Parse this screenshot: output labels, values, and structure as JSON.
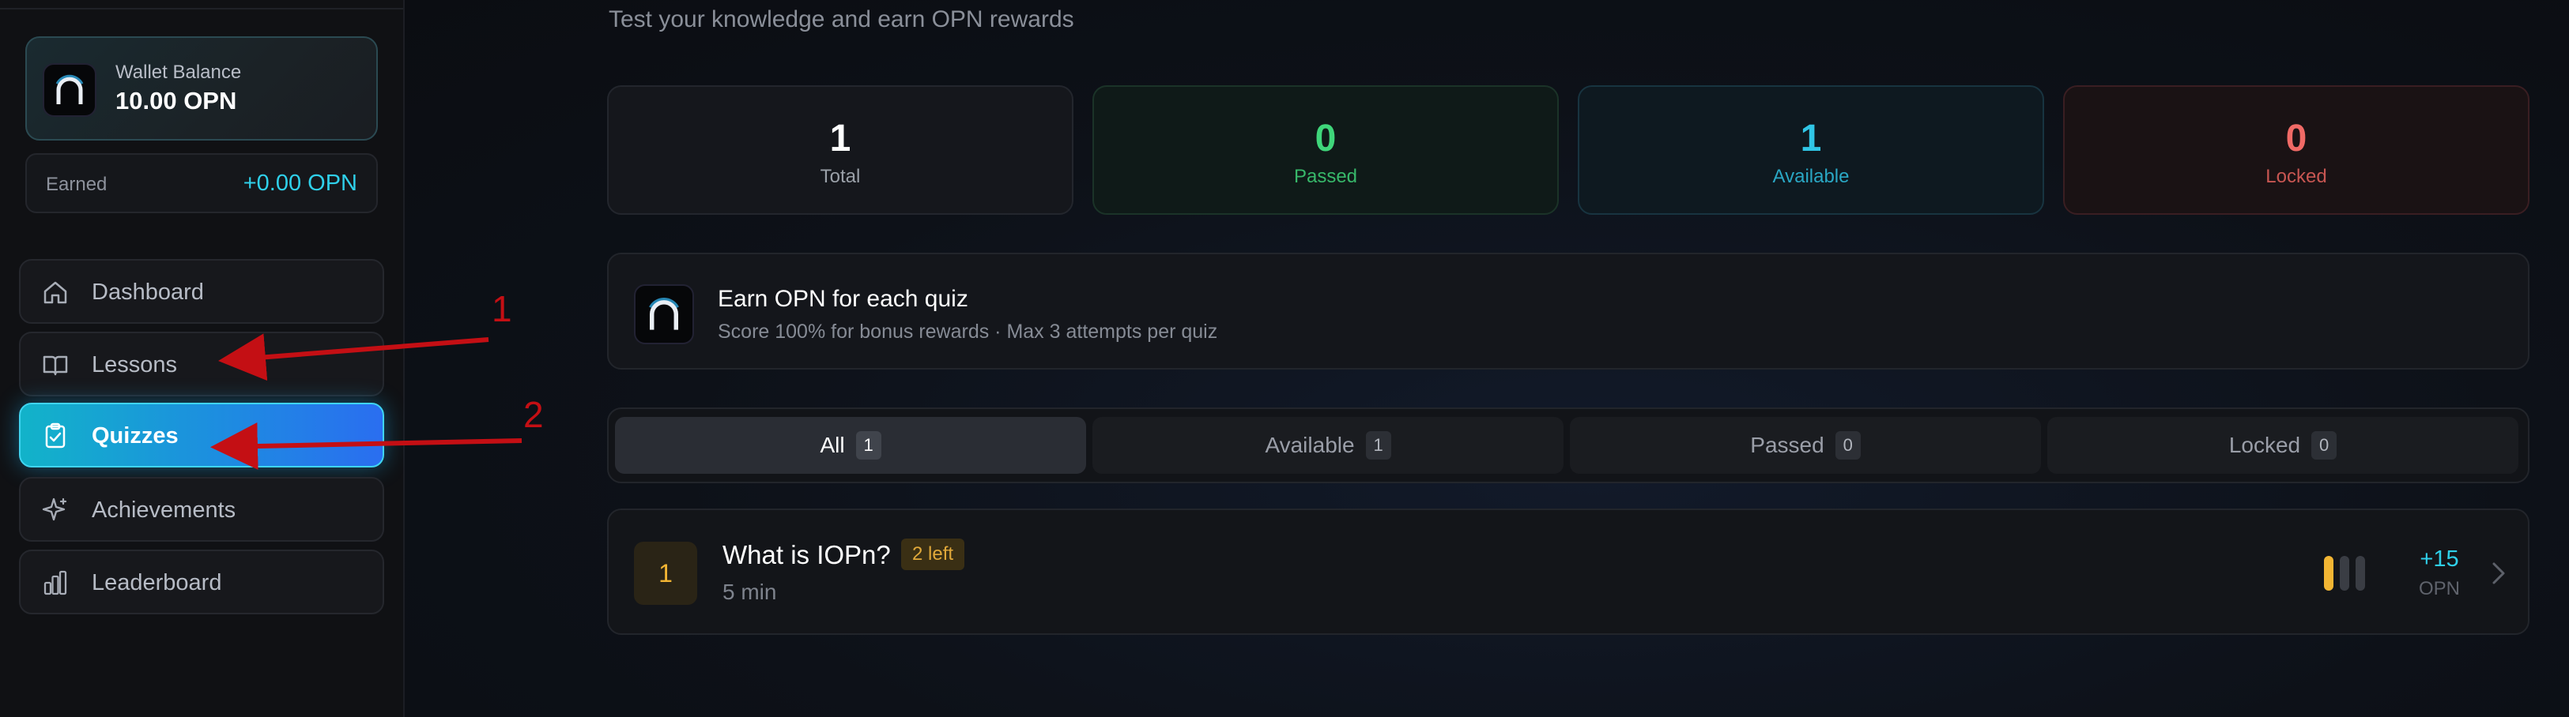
{
  "sidebar": {
    "wallet": {
      "label": "Wallet Balance",
      "value": "10.00 OPN"
    },
    "earned": {
      "label": "Earned",
      "value": "+0.00 OPN"
    },
    "nav": [
      {
        "label": "Dashboard",
        "icon": "home-icon"
      },
      {
        "label": "Lessons",
        "icon": "book-icon"
      },
      {
        "label": "Quizzes",
        "icon": "clipboard-check-icon"
      },
      {
        "label": "Achievements",
        "icon": "sparkle-icon"
      },
      {
        "label": "Leaderboard",
        "icon": "bar-chart-icon"
      }
    ],
    "active_item": "Quizzes"
  },
  "main": {
    "subtitle": "Test your knowledge and earn OPN rewards",
    "stats": [
      {
        "value": "1",
        "label": "Total",
        "color": "#ffffff",
        "label_color": "#9aa0a8"
      },
      {
        "value": "0",
        "label": "Passed",
        "color": "#3fd67a",
        "label_color": "#37b86a"
      },
      {
        "value": "1",
        "label": "Available",
        "color": "#30c6e6",
        "label_color": "#2aa7c4"
      },
      {
        "value": "0",
        "label": "Locked",
        "color": "#f06a66",
        "label_color": "#c85652"
      }
    ],
    "banner": {
      "title": "Earn OPN for each quiz",
      "description": "Score 100% for bonus rewards · Max 3 attempts per quiz"
    },
    "tabs": [
      {
        "label": "All",
        "count": "1"
      },
      {
        "label": "Available",
        "count": "1"
      },
      {
        "label": "Passed",
        "count": "0"
      },
      {
        "label": "Locked",
        "count": "0"
      }
    ],
    "active_tab": "All",
    "quizzes": [
      {
        "number": "1",
        "title": "What is IOPn?",
        "attempts_badge": "2 left",
        "duration": "5 min",
        "attempts_used": 1,
        "attempts_max": 3,
        "reward": "+15",
        "reward_unit": "OPN"
      }
    ]
  },
  "annotations": [
    {
      "label": "1",
      "target": "Lessons"
    },
    {
      "label": "2",
      "target": "Quizzes"
    }
  ],
  "colors": {
    "accent": "#1d8de0",
    "accent_cyan": "#2fd0ea",
    "warning": "#f2b533",
    "annotation": "#c40f14"
  }
}
